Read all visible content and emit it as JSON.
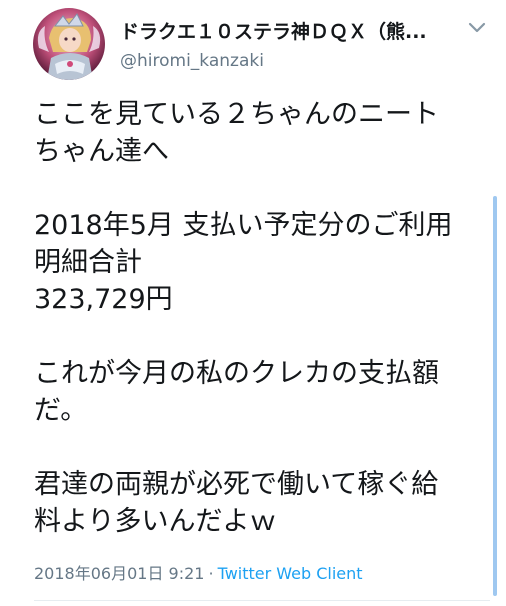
{
  "tweet": {
    "avatar_icon": "avatar-icon",
    "display_name": "ドラクエ１０ステラ神ＤＱＸ（熊...",
    "username": "@hiromi_kanzaki",
    "menu_icon": "chevron-down-icon",
    "paragraphs": [
      "ここを見ている２ちゃんのニート\nちゃん達へ",
      "2018年5月 支払い予定分のご利用\n明細合計\n323,729円",
      "これが今月の私のクレカの支払額\nだ。",
      "君達の両親が必死で働いて稼ぐ給\n料より多いんだよｗ"
    ],
    "timestamp": "2018年06月01日 9:21",
    "separator": "·",
    "client": "Twitter Web Client"
  },
  "colors": {
    "text": "#14171a",
    "secondary": "#657786",
    "link": "#1da1f2",
    "scrollbar": "#9fc8f0"
  }
}
